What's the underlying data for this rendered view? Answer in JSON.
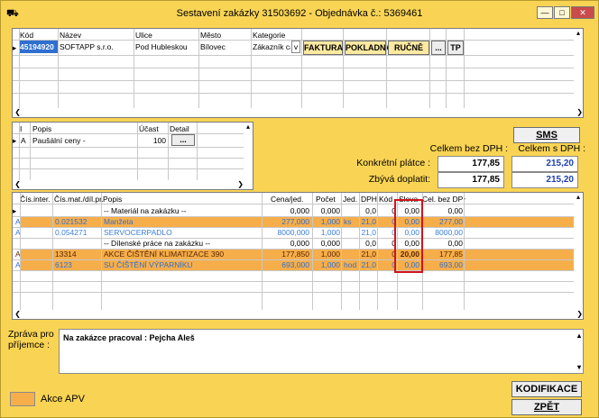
{
  "window": {
    "title": "Sestavení zakázky 31503692 - Objednávka č.: 5369461",
    "btn_min": "—",
    "btn_max": "□",
    "btn_close": "✕"
  },
  "customer": {
    "headers": [
      "Kód",
      "Název",
      "Ulice",
      "Město",
      "Kategorie"
    ],
    "row": {
      "kod": "45194920",
      "nazev": "SOFTAPP s.r.o.",
      "ulice": "Pod Hubleskou",
      "mesto": "Bílovec",
      "kategorie": "Zákazník ca"
    },
    "buttons": {
      "faktura": "FAKTURA",
      "pokladna": "POKLADNA",
      "rucne": "RUČNĚ",
      "more": "...",
      "tp": "TP"
    }
  },
  "items_small": {
    "headers": [
      "I",
      "Popis",
      "Účast",
      "Detail"
    ],
    "row": {
      "i": "A",
      "popis": "Paušální ceny -",
      "ucast": "100",
      "detail": "..."
    }
  },
  "summary": {
    "sms": "SMS",
    "h_bez": "Celkem bez DPH :",
    "h_s": "Celkem s DPH :",
    "konkretni_label": "Konkrétní plátce :",
    "konkretni_bez": "177,85",
    "konkretni_s": "215,20",
    "zbyva_label": "Zbývá doplatit:",
    "zbyva_bez": "177,85",
    "zbyva_s": "215,20"
  },
  "lines": {
    "headers": {
      "cis": "Čís.inter.",
      "mat": "Čís.mat./díl.pr.",
      "popis": "Popis",
      "cena": "Cena/jed.",
      "pocet": "Počet",
      "jed": "Jed.",
      "dph": "DPH",
      "kod": "Kód",
      "sleva": "Sleva",
      "celbez": "Cel. bez DPH"
    },
    "rows": [
      {
        "a": "",
        "cis": "",
        "mat": "",
        "popis": "-- Materiál na zakázku --",
        "cena": "0,000",
        "pocet": "0,000",
        "jed": "",
        "dph": "0,0",
        "kod": "0",
        "sleva": "0,00",
        "celbez": "0,00",
        "style": "plain"
      },
      {
        "a": "A",
        "cis": "0.021532",
        "mat": "",
        "popis": "Manžeta",
        "cena": "277,000",
        "pocet": "1,000",
        "jed": "ks",
        "dph": "21,0",
        "kod": "0",
        "sleva": "0,00",
        "celbez": "277,00",
        "style": "orange-blue"
      },
      {
        "a": "A",
        "cis": "0.054271",
        "mat": "",
        "popis": "SERVOCERPADLO",
        "cena": "8000,000",
        "pocet": "1,000",
        "jed": "",
        "dph": "21,0",
        "kod": "0",
        "sleva": "0,00",
        "celbez": "8000,00",
        "style": "blue"
      },
      {
        "a": "",
        "cis": "",
        "mat": "",
        "popis": "-- Dílenské práce na zakázku --",
        "cena": "0,000",
        "pocet": "0,000",
        "jed": "",
        "dph": "0,0",
        "kod": "0",
        "sleva": "0,00",
        "celbez": "0,00",
        "style": "plain"
      },
      {
        "a": "A",
        "cis": "13314",
        "mat": "",
        "popis": "AKCE ČIŠTĚNÍ KLIMATIZACE 390",
        "cena": "177,850",
        "pocet": "1,000",
        "jed": "",
        "dph": "21,0",
        "kod": "0",
        "sleva": "20,00",
        "celbez": "177,85",
        "style": "orange"
      },
      {
        "a": "A",
        "cis": "6123",
        "mat": "",
        "popis": "SU ČIŠTĚNÍ VÝPARNÍKU",
        "cena": "693,000",
        "pocet": "1,000",
        "jed": "hod",
        "dph": "21,0",
        "kod": "0",
        "sleva": "0,00",
        "celbez": "693,00",
        "style": "orange-blue"
      }
    ]
  },
  "message": {
    "label": "Zpráva pro příjemce :",
    "text": "Na zakázce pracoval : Pejcha Aleš"
  },
  "legend": {
    "label": "Akce APV",
    "color": "#f6ae4a"
  },
  "actions": {
    "kodifikace": "KODIFIKACE",
    "zpet": "ZPĚT"
  }
}
